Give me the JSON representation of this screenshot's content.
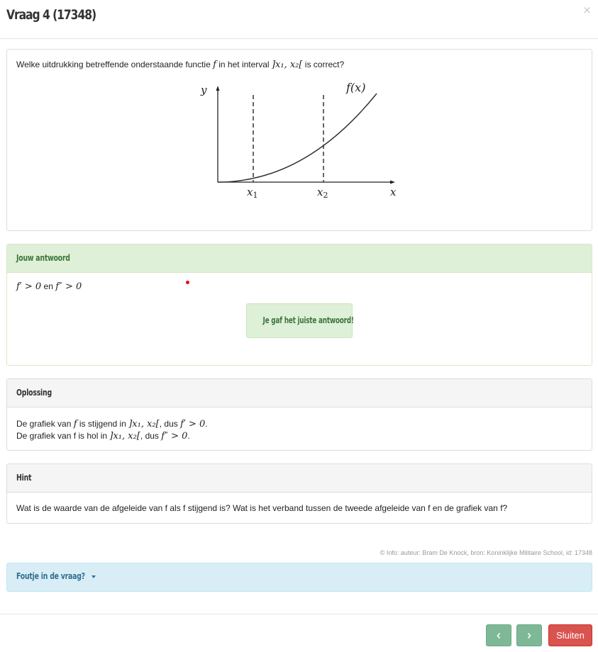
{
  "header": {
    "title": "Vraag 4 (17348)",
    "close_symbol": "×"
  },
  "question": {
    "text_before": "Welke uitdrukking betreffende onderstaande functie ",
    "func": "f",
    "text_mid": " in het interval ",
    "interval": "]x₁, x₂[",
    "text_after": " is correct?",
    "graph": {
      "y_label": "y",
      "x_label": "x",
      "curve_label": "f(x)",
      "x1_label": "x",
      "x1_sub": "1",
      "x2_label": "x",
      "x2_sub": "2"
    }
  },
  "answer": {
    "heading": "Jouw antwoord",
    "expr1": "f′ > 0",
    "conj": " en ",
    "expr2": "f″ > 0",
    "feedback": "Je gaf het juiste antwoord!"
  },
  "solution": {
    "heading": "Oplossing",
    "l1_a": "De grafiek van ",
    "l1_f": "f",
    "l1_b": " is stijgend in ",
    "l1_interval": "]x₁, x₂[",
    "l1_c": ", dus ",
    "l1_expr": "f′ > 0",
    "l1_end": ".",
    "l2_a": "De grafiek van f is hol in ",
    "l2_interval": "]x₁, x₂[",
    "l2_c": ", dus ",
    "l2_expr": "f″ > 0",
    "l2_end": "."
  },
  "hint": {
    "heading": "Hint",
    "text": "Wat is de waarde van de afgeleide van f als f stijgend is? Wat is het verband tussen de tweede afgeleide van f en de grafiek van f?"
  },
  "info": "© Info: auteur: Bram De Knock, bron: Koninklijke Militaire School, id: 17348",
  "fault": {
    "label": "Foutje in de vraag?"
  },
  "footer": {
    "prev_icon": "chevron-left-icon",
    "next_icon": "chevron-right-icon",
    "close_label": "Sluiten"
  },
  "colors": {
    "answer_bg": "#dff0d8",
    "answer_text": "#3c763d",
    "info_bg": "#d9edf7",
    "info_text": "#31708f",
    "nav_btn": "#7fb896",
    "close_btn": "#d9534f"
  }
}
